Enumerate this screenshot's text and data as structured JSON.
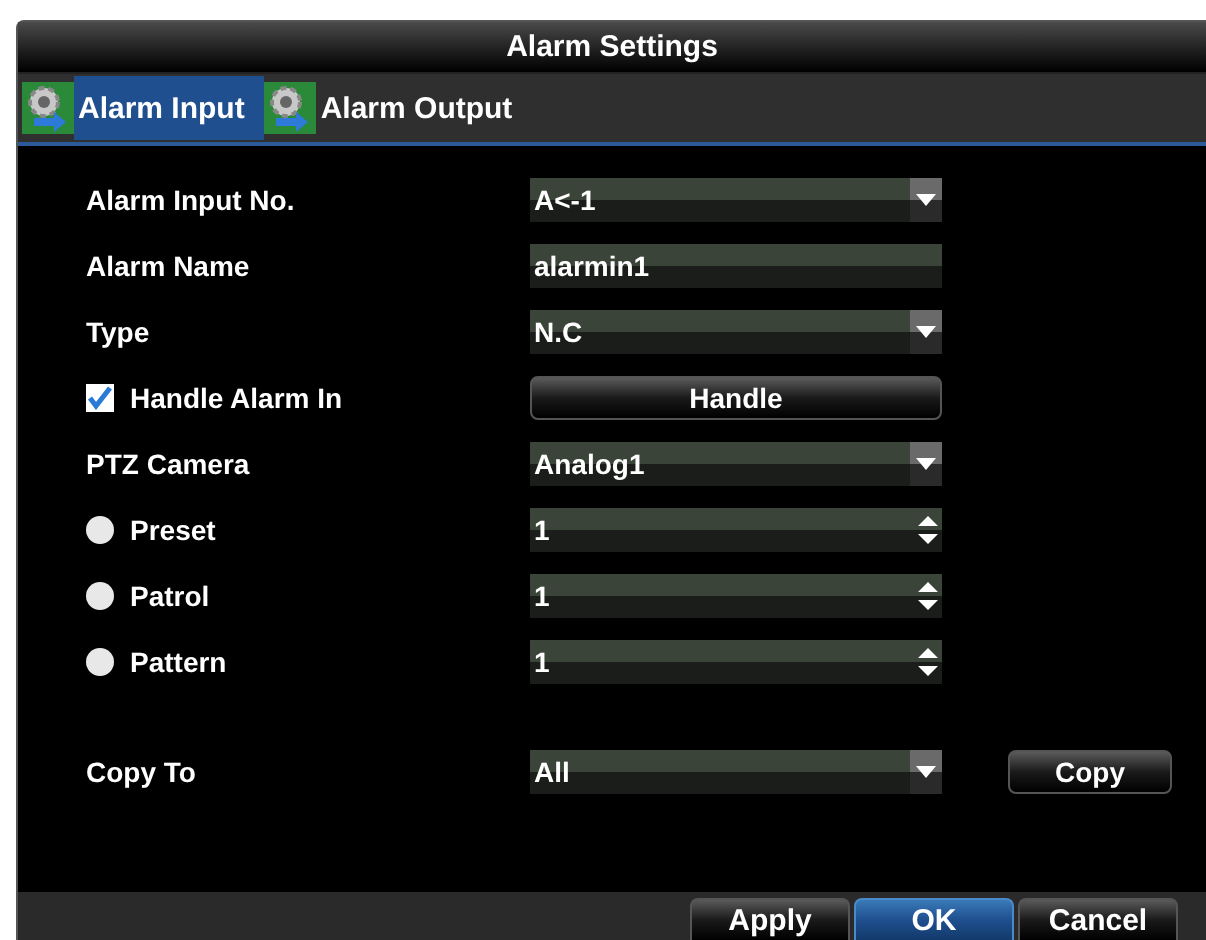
{
  "window": {
    "title": "Alarm Settings"
  },
  "tabs": [
    {
      "label": "Alarm Input",
      "selected": true
    },
    {
      "label": "Alarm Output",
      "selected": false
    }
  ],
  "rows": [
    {
      "label": "Alarm Input No.",
      "kind": "plain",
      "control": {
        "kind": "dropdown",
        "value": "A<-1"
      }
    },
    {
      "label": "Alarm Name",
      "kind": "plain",
      "control": {
        "kind": "text",
        "value": "alarmin1"
      }
    },
    {
      "label": "Type",
      "kind": "plain",
      "control": {
        "kind": "dropdown",
        "value": "N.C"
      }
    },
    {
      "label": "Handle Alarm In",
      "kind": "checkbox",
      "checked": true,
      "control": {
        "kind": "button",
        "value": "Handle"
      }
    },
    {
      "label": "PTZ Camera",
      "kind": "plain",
      "control": {
        "kind": "dropdown",
        "value": "Analog1"
      }
    },
    {
      "label": "Preset",
      "kind": "radio",
      "selected": false,
      "control": {
        "kind": "spinner",
        "value": "1"
      }
    },
    {
      "label": "Patrol",
      "kind": "radio",
      "selected": false,
      "control": {
        "kind": "spinner",
        "value": "1"
      }
    },
    {
      "label": "Pattern",
      "kind": "radio",
      "selected": false,
      "control": {
        "kind": "spinner",
        "value": "1"
      }
    }
  ],
  "copy": {
    "label": "Copy To",
    "value": "All",
    "button": "Copy"
  },
  "buttons": [
    {
      "label": "Apply",
      "selected": false
    },
    {
      "label": "OK",
      "selected": true
    },
    {
      "label": "Cancel",
      "selected": false
    }
  ]
}
